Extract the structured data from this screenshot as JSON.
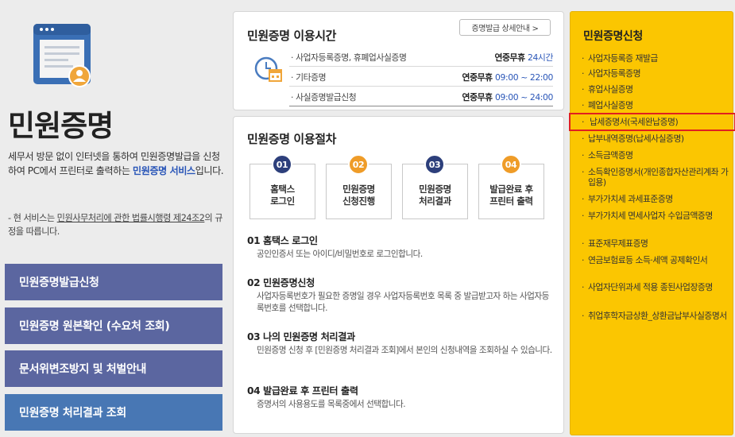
{
  "left": {
    "title": "민원증명",
    "desc_part1": "세무서 방문 없이 인터넷을 통하여 민원증명발급을 신청하여 PC에서 프린터로 출력하는 ",
    "desc_highlight": "민원증명 서비스",
    "desc_part2": "입니다.",
    "note_prefix": "- 현 서비스는 ",
    "note_underline": "민원사무처리에 관한 법률시행령 제24조2",
    "note_suffix": "의 규정을 따릅니다.",
    "buttons": [
      "민원증명발급신청",
      "민원증명 원본확인 (수요처 조회)",
      "문서위변조방지 및 처벌안내",
      "민원증명 처리결과 조회"
    ]
  },
  "hours": {
    "title": "민원증명 이용시간",
    "detail_button": "증명발급 상세안내 >",
    "rows": [
      {
        "name": "· 사업자등록증명, 휴폐업사실증명",
        "label": "연중무휴 ",
        "time": "24시간"
      },
      {
        "name": "· 기타증명",
        "label": "연중무휴 ",
        "time": "09:00 ~ 22:00"
      },
      {
        "name": "· 사실증명발급신청",
        "label": "연중무휴 ",
        "time": "09:00 ~ 24:00"
      }
    ]
  },
  "procedure": {
    "title": "민원증명 이용절차",
    "steps": [
      {
        "num": "01",
        "line1": "홈택스",
        "line2": "로그인"
      },
      {
        "num": "02",
        "line1": "민원증명",
        "line2": "신청진행"
      },
      {
        "num": "03",
        "line1": "민원증명",
        "line2": "처리결과"
      },
      {
        "num": "04",
        "line1": "발급완료 후",
        "line2": "프린터 출력"
      }
    ],
    "sections": [
      {
        "heading": "01 홈택스 로그인",
        "text": "공인인증서 또는 아이디/비밀번호로 로그인합니다."
      },
      {
        "heading": "02 민원증명신청",
        "text": "사업자등록번호가 필요한 증명일 경우 사업자등록번호 목록 중 발급받고자 하는 사업자등록번호를 선택합니다."
      },
      {
        "heading": "03 나의 민원증명 처리결과",
        "text": "민원증명 신청 후 [민원증명 처리결과 조회]에서 본인의 신청내역을 조회하실 수 있습니다."
      },
      {
        "heading": "04 발급완료 후 프린터 출력",
        "text": "증명서의 사용용도를 목록중에서 선택합니다."
      }
    ]
  },
  "apply": {
    "title": "민원증명신청",
    "items": [
      "사업자등록증 재발급",
      "사업자등록증명",
      "휴업사실증명",
      "폐업사실증명",
      "납세증명서(국세완납증명)",
      "납부내역증명(납세사실증명)",
      "소득금액증명",
      "소득확인증명서(개인종합자산관리계좌 가입용)",
      "부가가치세 과세표준증명",
      "부가가치세 면세사업자 수입금액증명",
      "표준재무제표증명",
      "연금보험료등 소득·세액 공제확인서",
      "사업자단위과세 적용 종된사업장증명",
      "취업후학자금상환_상환금납부사실증명서"
    ]
  },
  "colors": {
    "accent_yellow": "#fbc601",
    "button_purple": "#5b66a0",
    "button_blue": "#4877b4",
    "highlight_blue": "#2a56b8",
    "step_navy": "#2d3f7b",
    "step_orange": "#ef9c28",
    "selection_red": "#e02020"
  }
}
